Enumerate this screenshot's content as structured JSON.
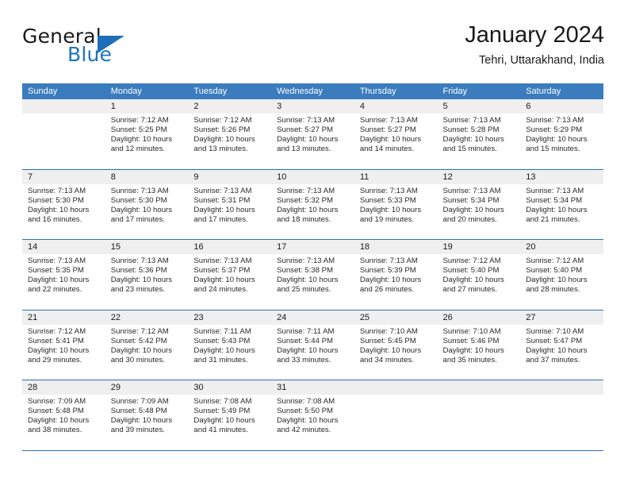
{
  "brand": {
    "word_general": "General",
    "word_blue": "Blue",
    "triangle_color": "#1c6fb8",
    "blue_color": "#1c74bc"
  },
  "header": {
    "title": "January 2024",
    "subtitle": "Tehri, Uttarakhand, India"
  },
  "theme": {
    "header_row_bg": "#3a7cbe",
    "row_separator": "#2f6fb0",
    "daynum_band_bg": "#efefef"
  },
  "calendar": {
    "weekday_headers": [
      "Sunday",
      "Monday",
      "Tuesday",
      "Wednesday",
      "Thursday",
      "Friday",
      "Saturday"
    ],
    "weeks": [
      [
        {
          "day": "",
          "sunrise": "",
          "sunset": "",
          "daylight_line1": "",
          "daylight_line2": ""
        },
        {
          "day": "1",
          "sunrise": "Sunrise: 7:12 AM",
          "sunset": "Sunset: 5:25 PM",
          "daylight_line1": "Daylight: 10 hours",
          "daylight_line2": "and 12 minutes."
        },
        {
          "day": "2",
          "sunrise": "Sunrise: 7:12 AM",
          "sunset": "Sunset: 5:26 PM",
          "daylight_line1": "Daylight: 10 hours",
          "daylight_line2": "and 13 minutes."
        },
        {
          "day": "3",
          "sunrise": "Sunrise: 7:13 AM",
          "sunset": "Sunset: 5:27 PM",
          "daylight_line1": "Daylight: 10 hours",
          "daylight_line2": "and 13 minutes."
        },
        {
          "day": "4",
          "sunrise": "Sunrise: 7:13 AM",
          "sunset": "Sunset: 5:27 PM",
          "daylight_line1": "Daylight: 10 hours",
          "daylight_line2": "and 14 minutes."
        },
        {
          "day": "5",
          "sunrise": "Sunrise: 7:13 AM",
          "sunset": "Sunset: 5:28 PM",
          "daylight_line1": "Daylight: 10 hours",
          "daylight_line2": "and 15 minutes."
        },
        {
          "day": "6",
          "sunrise": "Sunrise: 7:13 AM",
          "sunset": "Sunset: 5:29 PM",
          "daylight_line1": "Daylight: 10 hours",
          "daylight_line2": "and 15 minutes."
        }
      ],
      [
        {
          "day": "7",
          "sunrise": "Sunrise: 7:13 AM",
          "sunset": "Sunset: 5:30 PM",
          "daylight_line1": "Daylight: 10 hours",
          "daylight_line2": "and 16 minutes."
        },
        {
          "day": "8",
          "sunrise": "Sunrise: 7:13 AM",
          "sunset": "Sunset: 5:30 PM",
          "daylight_line1": "Daylight: 10 hours",
          "daylight_line2": "and 17 minutes."
        },
        {
          "day": "9",
          "sunrise": "Sunrise: 7:13 AM",
          "sunset": "Sunset: 5:31 PM",
          "daylight_line1": "Daylight: 10 hours",
          "daylight_line2": "and 17 minutes."
        },
        {
          "day": "10",
          "sunrise": "Sunrise: 7:13 AM",
          "sunset": "Sunset: 5:32 PM",
          "daylight_line1": "Daylight: 10 hours",
          "daylight_line2": "and 18 minutes."
        },
        {
          "day": "11",
          "sunrise": "Sunrise: 7:13 AM",
          "sunset": "Sunset: 5:33 PM",
          "daylight_line1": "Daylight: 10 hours",
          "daylight_line2": "and 19 minutes."
        },
        {
          "day": "12",
          "sunrise": "Sunrise: 7:13 AM",
          "sunset": "Sunset: 5:34 PM",
          "daylight_line1": "Daylight: 10 hours",
          "daylight_line2": "and 20 minutes."
        },
        {
          "day": "13",
          "sunrise": "Sunrise: 7:13 AM",
          "sunset": "Sunset: 5:34 PM",
          "daylight_line1": "Daylight: 10 hours",
          "daylight_line2": "and 21 minutes."
        }
      ],
      [
        {
          "day": "14",
          "sunrise": "Sunrise: 7:13 AM",
          "sunset": "Sunset: 5:35 PM",
          "daylight_line1": "Daylight: 10 hours",
          "daylight_line2": "and 22 minutes."
        },
        {
          "day": "15",
          "sunrise": "Sunrise: 7:13 AM",
          "sunset": "Sunset: 5:36 PM",
          "daylight_line1": "Daylight: 10 hours",
          "daylight_line2": "and 23 minutes."
        },
        {
          "day": "16",
          "sunrise": "Sunrise: 7:13 AM",
          "sunset": "Sunset: 5:37 PM",
          "daylight_line1": "Daylight: 10 hours",
          "daylight_line2": "and 24 minutes."
        },
        {
          "day": "17",
          "sunrise": "Sunrise: 7:13 AM",
          "sunset": "Sunset: 5:38 PM",
          "daylight_line1": "Daylight: 10 hours",
          "daylight_line2": "and 25 minutes."
        },
        {
          "day": "18",
          "sunrise": "Sunrise: 7:13 AM",
          "sunset": "Sunset: 5:39 PM",
          "daylight_line1": "Daylight: 10 hours",
          "daylight_line2": "and 26 minutes."
        },
        {
          "day": "19",
          "sunrise": "Sunrise: 7:12 AM",
          "sunset": "Sunset: 5:40 PM",
          "daylight_line1": "Daylight: 10 hours",
          "daylight_line2": "and 27 minutes."
        },
        {
          "day": "20",
          "sunrise": "Sunrise: 7:12 AM",
          "sunset": "Sunset: 5:40 PM",
          "daylight_line1": "Daylight: 10 hours",
          "daylight_line2": "and 28 minutes."
        }
      ],
      [
        {
          "day": "21",
          "sunrise": "Sunrise: 7:12 AM",
          "sunset": "Sunset: 5:41 PM",
          "daylight_line1": "Daylight: 10 hours",
          "daylight_line2": "and 29 minutes."
        },
        {
          "day": "22",
          "sunrise": "Sunrise: 7:12 AM",
          "sunset": "Sunset: 5:42 PM",
          "daylight_line1": "Daylight: 10 hours",
          "daylight_line2": "and 30 minutes."
        },
        {
          "day": "23",
          "sunrise": "Sunrise: 7:11 AM",
          "sunset": "Sunset: 5:43 PM",
          "daylight_line1": "Daylight: 10 hours",
          "daylight_line2": "and 31 minutes."
        },
        {
          "day": "24",
          "sunrise": "Sunrise: 7:11 AM",
          "sunset": "Sunset: 5:44 PM",
          "daylight_line1": "Daylight: 10 hours",
          "daylight_line2": "and 33 minutes."
        },
        {
          "day": "25",
          "sunrise": "Sunrise: 7:10 AM",
          "sunset": "Sunset: 5:45 PM",
          "daylight_line1": "Daylight: 10 hours",
          "daylight_line2": "and 34 minutes."
        },
        {
          "day": "26",
          "sunrise": "Sunrise: 7:10 AM",
          "sunset": "Sunset: 5:46 PM",
          "daylight_line1": "Daylight: 10 hours",
          "daylight_line2": "and 35 minutes."
        },
        {
          "day": "27",
          "sunrise": "Sunrise: 7:10 AM",
          "sunset": "Sunset: 5:47 PM",
          "daylight_line1": "Daylight: 10 hours",
          "daylight_line2": "and 37 minutes."
        }
      ],
      [
        {
          "day": "28",
          "sunrise": "Sunrise: 7:09 AM",
          "sunset": "Sunset: 5:48 PM",
          "daylight_line1": "Daylight: 10 hours",
          "daylight_line2": "and 38 minutes."
        },
        {
          "day": "29",
          "sunrise": "Sunrise: 7:09 AM",
          "sunset": "Sunset: 5:48 PM",
          "daylight_line1": "Daylight: 10 hours",
          "daylight_line2": "and 39 minutes."
        },
        {
          "day": "30",
          "sunrise": "Sunrise: 7:08 AM",
          "sunset": "Sunset: 5:49 PM",
          "daylight_line1": "Daylight: 10 hours",
          "daylight_line2": "and 41 minutes."
        },
        {
          "day": "31",
          "sunrise": "Sunrise: 7:08 AM",
          "sunset": "Sunset: 5:50 PM",
          "daylight_line1": "Daylight: 10 hours",
          "daylight_line2": "and 42 minutes."
        },
        {
          "day": "",
          "sunrise": "",
          "sunset": "",
          "daylight_line1": "",
          "daylight_line2": ""
        },
        {
          "day": "",
          "sunrise": "",
          "sunset": "",
          "daylight_line1": "",
          "daylight_line2": ""
        },
        {
          "day": "",
          "sunrise": "",
          "sunset": "",
          "daylight_line1": "",
          "daylight_line2": ""
        }
      ]
    ]
  }
}
